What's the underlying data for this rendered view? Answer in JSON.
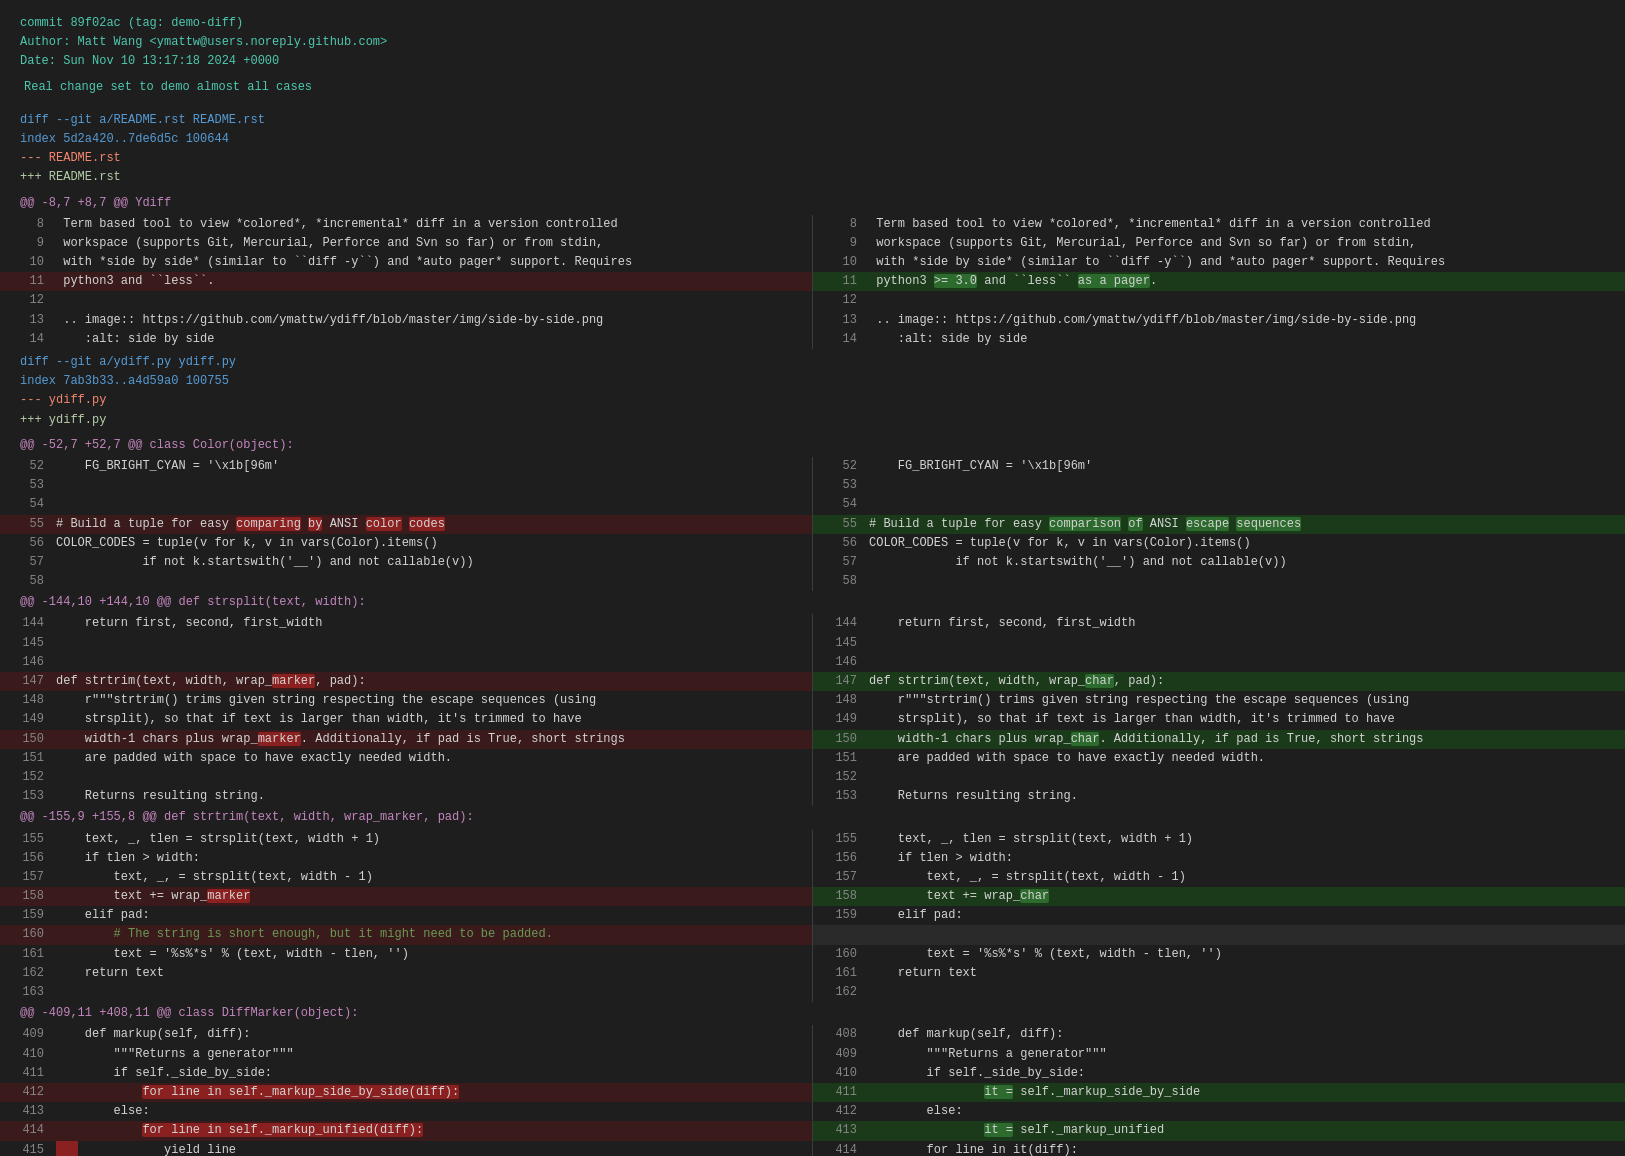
{
  "commit": {
    "hash_label": "commit 89f02ac (tag: demo-diff)",
    "author_label": "Author: Matt Wang <ymattw@users.noreply.github.com>",
    "date_label": "Date:   Sun Nov 10 13:17:18 2024 +0000",
    "message": "Real change set to demo almost all cases"
  },
  "files": [
    {
      "id": "readme",
      "diff_cmd": "diff --git a/README.rst README.rst",
      "index_line": "index 5d2a420..7de6d5c 100644",
      "minus_file": "--- README.rst",
      "plus_file": "+++ README.rst",
      "hunks": [
        {
          "header": "@@ -8,7 +8,7 @@ Ydiff"
        }
      ]
    },
    {
      "id": "ydiff",
      "diff_cmd": "diff --git a/ydiff.py ydiff.py",
      "index_line": "index 7ab3b33..a4d59a0 100755",
      "minus_file": "--- ydiff.py",
      "plus_file": "+++ ydiff.py"
    }
  ],
  "colors": {
    "bg": "#1e1e1e",
    "add_bg": "#1a3a1a",
    "del_bg": "#3a1a1a",
    "hl_add": "#2d6a2d",
    "hl_del": "#8b2020"
  }
}
